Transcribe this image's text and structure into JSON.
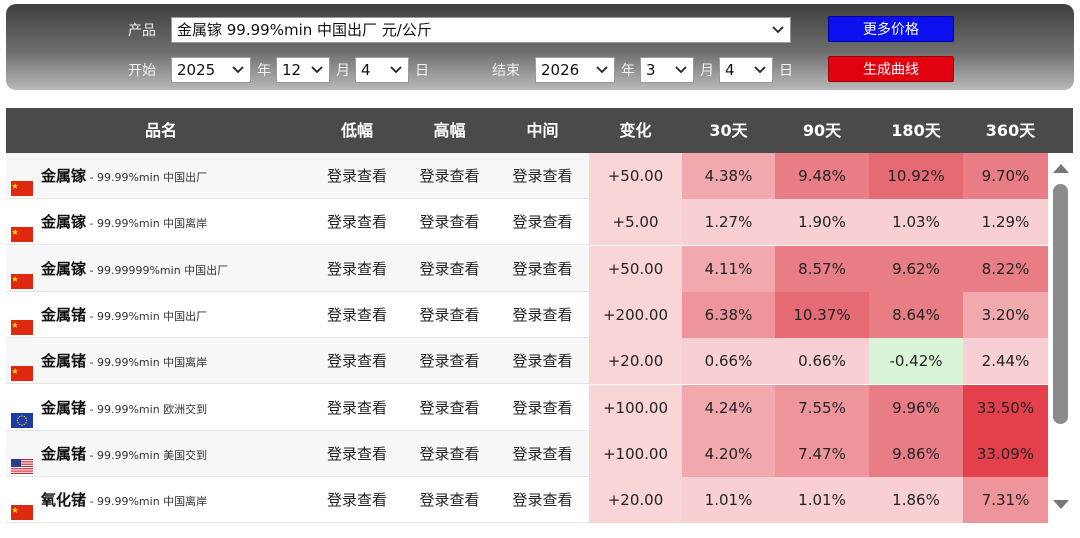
{
  "filters": {
    "product_label": "产品",
    "product_value": "金属镓 99.99%min 中国出厂 元/公斤",
    "start_label": "开始",
    "end_label": "结束",
    "start": {
      "year": "2025",
      "month": "12",
      "day": "4"
    },
    "end": {
      "year": "2026",
      "month": "3",
      "day": "4"
    },
    "unit_year": "年",
    "unit_month": "月",
    "unit_day": "日",
    "more_prices_button": "更多价格",
    "generate_curve_button": "生成曲线"
  },
  "table": {
    "headers": [
      "品名",
      "低幅",
      "高幅",
      "中间",
      "变化",
      "30天",
      "90天",
      "180天",
      "360天"
    ],
    "rows": [
      {
        "flag": "cn-flag-icon",
        "name": "金属镓",
        "spec": " - 99.99%min 中国出厂",
        "low": "登录查看",
        "high": "登录查看",
        "mid": "登录查看",
        "change": "+50.00",
        "d30": "4.38%",
        "d90": "9.48%",
        "d180": "10.92%",
        "d360": "9.70%"
      },
      {
        "flag": "cn-flag-icon",
        "name": "金属镓",
        "spec": " - 99.99%min 中国离岸",
        "low": "登录查看",
        "high": "登录查看",
        "mid": "登录查看",
        "change": "+5.00",
        "d30": "1.27%",
        "d90": "1.90%",
        "d180": "1.03%",
        "d360": "1.29%"
      },
      {
        "flag": "cn-flag-icon",
        "name": "金属镓",
        "spec": " - 99.99999%min 中国出厂",
        "low": "登录查看",
        "high": "登录查看",
        "mid": "登录查看",
        "change": "+50.00",
        "d30": "4.11%",
        "d90": "8.57%",
        "d180": "9.62%",
        "d360": "8.22%"
      },
      {
        "flag": "cn-flag-icon",
        "name": "金属锗",
        "spec": " - 99.99%min 中国出厂",
        "low": "登录查看",
        "high": "登录查看",
        "mid": "登录查看",
        "change": "+200.00",
        "d30": "6.38%",
        "d90": "10.37%",
        "d180": "8.64%",
        "d360": "3.20%"
      },
      {
        "flag": "cn-flag-icon",
        "name": "金属锗",
        "spec": " - 99.99%min 中国离岸",
        "low": "登录查看",
        "high": "登录查看",
        "mid": "登录查看",
        "change": "+20.00",
        "d30": "0.66%",
        "d90": "0.66%",
        "d180": "-0.42%",
        "d360": "2.44%"
      },
      {
        "flag": "eu-flag-icon",
        "name": "金属锗",
        "spec": " - 99.99%min 欧洲交到",
        "low": "登录查看",
        "high": "登录查看",
        "mid": "登录查看",
        "change": "+100.00",
        "d30": "4.24%",
        "d90": "7.55%",
        "d180": "9.96%",
        "d360": "33.50%"
      },
      {
        "flag": "us-flag-icon",
        "name": "金属锗",
        "spec": " - 99.99%min 美国交到",
        "low": "登录查看",
        "high": "登录查看",
        "mid": "登录查看",
        "change": "+100.00",
        "d30": "4.20%",
        "d90": "7.47%",
        "d180": "9.86%",
        "d360": "33.09%"
      },
      {
        "flag": "cn-flag-icon",
        "name": "氧化锗",
        "spec": " - 99.99%min 中国离岸",
        "low": "登录查看",
        "high": "登录查看",
        "mid": "登录查看",
        "change": "+20.00",
        "d30": "1.01%",
        "d90": "1.01%",
        "d180": "1.86%",
        "d360": "7.31%"
      }
    ]
  },
  "colors": {
    "header_bg": "#4a4a4a",
    "button_blue": "#0a10ee",
    "button_red": "#e1000e",
    "negative_cell": "#d6f5d6"
  }
}
